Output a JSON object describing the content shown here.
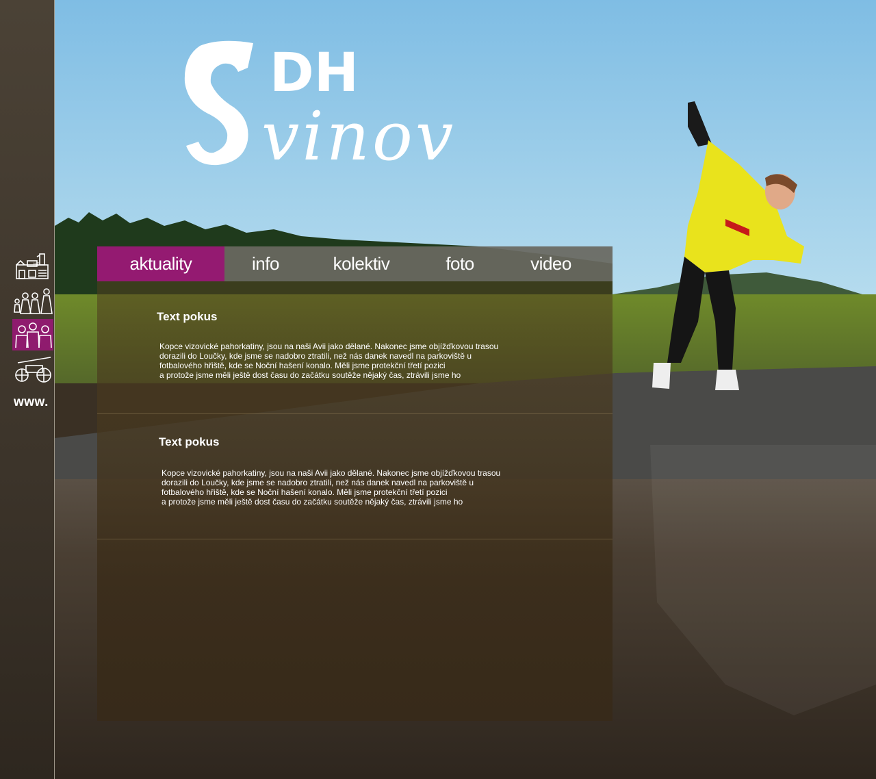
{
  "logo": {
    "line1": "DH",
    "letter_s": "S",
    "line2": "vinov"
  },
  "sidebar": {
    "items": [
      {
        "icon": "fire-station-icon",
        "label": ""
      },
      {
        "icon": "family-icon",
        "label": ""
      },
      {
        "icon": "team-icon",
        "label": ""
      },
      {
        "icon": "fire-cart-icon",
        "label": ""
      }
    ],
    "active_index": 2,
    "www_label": "www."
  },
  "nav": {
    "items": [
      {
        "label": "aktuality",
        "active": true
      },
      {
        "label": "info",
        "active": false
      },
      {
        "label": "kolektiv",
        "active": false
      },
      {
        "label": "foto",
        "active": false
      },
      {
        "label": "video",
        "active": false
      }
    ]
  },
  "articles": [
    {
      "title": "Text pokus",
      "body": "Kopce vizovické pahorkatiny, jsou na naši Avii jako dělané. Nakonec jsme objížďkovou trasou\ndorazili do Loučky, kde jsme se nadobro ztratili, než nás danek navedl na parkoviště u\nfotbalového hřiště, kde se Noční hašení konalo. Měli jsme protekční třetí pozici\na protože jsme měli ještě dost času do začátku soutěže nějaký čas, ztrávili jsme ho"
    },
    {
      "title": "Text pokus",
      "body": "Kopce vizovické pahorkatiny, jsou na naši Avii jako dělané. Nakonec jsme objížďkovou trasou\ndorazili do Loučky, kde jsme se nadobro ztratili, než nás danek navedl na parkoviště u\nfotbalového hřiště, kde se Noční hašení konalo. Měli jsme protekční třetí pozici\na protože jsme měli ještě dost času do začátku soutěže nějaký čas, ztrávili jsme ho"
    }
  ],
  "colors": {
    "accent": "#941a71",
    "sky": "#8ec6e6",
    "nav_bg": "#696860",
    "sidebar_bg": "#4b4236"
  }
}
